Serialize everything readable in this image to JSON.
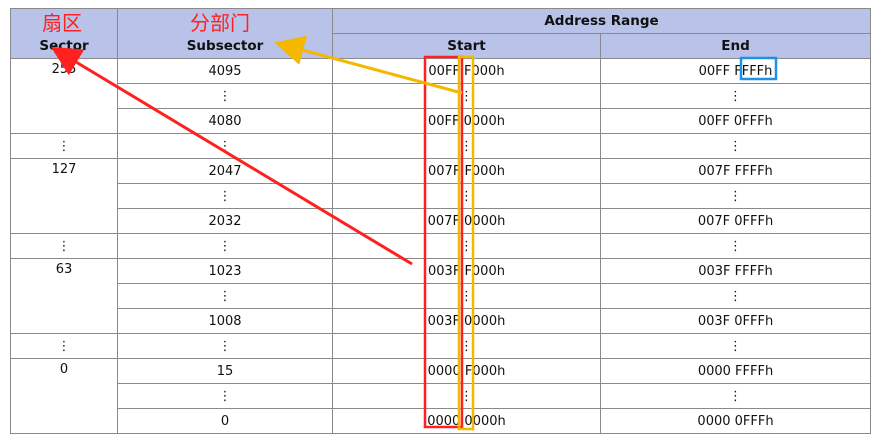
{
  "annotations": {
    "sector_cn": "扇区",
    "subsector_cn": "分部门"
  },
  "header": {
    "sector": "Sector",
    "subsector": "Subsector",
    "address_range": "Address Range",
    "start": "Start",
    "end": "End"
  },
  "rows": [
    {
      "sector": "255",
      "subsector": "4095",
      "start": "00FF F000h",
      "end": "00FF FFFFh"
    },
    {
      "sector": "",
      "subsector": "⋮",
      "start": "⋮",
      "end": "⋮"
    },
    {
      "sector": "",
      "subsector": "4080",
      "start": "00FF 0000h",
      "end": "00FF 0FFFh"
    },
    {
      "sector": "⋮",
      "subsector": "⋮",
      "start": "⋮",
      "end": "⋮"
    },
    {
      "sector": "127",
      "subsector": "2047",
      "start": "007F F000h",
      "end": "007F FFFFh"
    },
    {
      "sector": "",
      "subsector": "⋮",
      "start": "⋮",
      "end": "⋮"
    },
    {
      "sector": "",
      "subsector": "2032",
      "start": "007F 0000h",
      "end": "007F 0FFFh"
    },
    {
      "sector": "⋮",
      "subsector": "⋮",
      "start": "⋮",
      "end": "⋮"
    },
    {
      "sector": "63",
      "subsector": "1023",
      "start": "003F F000h",
      "end": "003F FFFFh"
    },
    {
      "sector": "",
      "subsector": "⋮",
      "start": "⋮",
      "end": "⋮"
    },
    {
      "sector": "",
      "subsector": "1008",
      "start": "003F 0000h",
      "end": "003F 0FFFh"
    },
    {
      "sector": "⋮",
      "subsector": "⋮",
      "start": "⋮",
      "end": "⋮"
    },
    {
      "sector": "0",
      "subsector": "15",
      "start": "0000 F000h",
      "end": "0000 FFFFh"
    },
    {
      "sector": "",
      "subsector": "⋮",
      "start": "⋮",
      "end": "⋮"
    },
    {
      "sector": "",
      "subsector": "0",
      "start": "0000 0000h",
      "end": "0000 0FFFh"
    }
  ],
  "colors": {
    "header_bg": "#b9c2e8",
    "red_annotation": "#ff2020",
    "yellow_annotation": "#f5b800",
    "blue_annotation": "#1e90e6"
  }
}
